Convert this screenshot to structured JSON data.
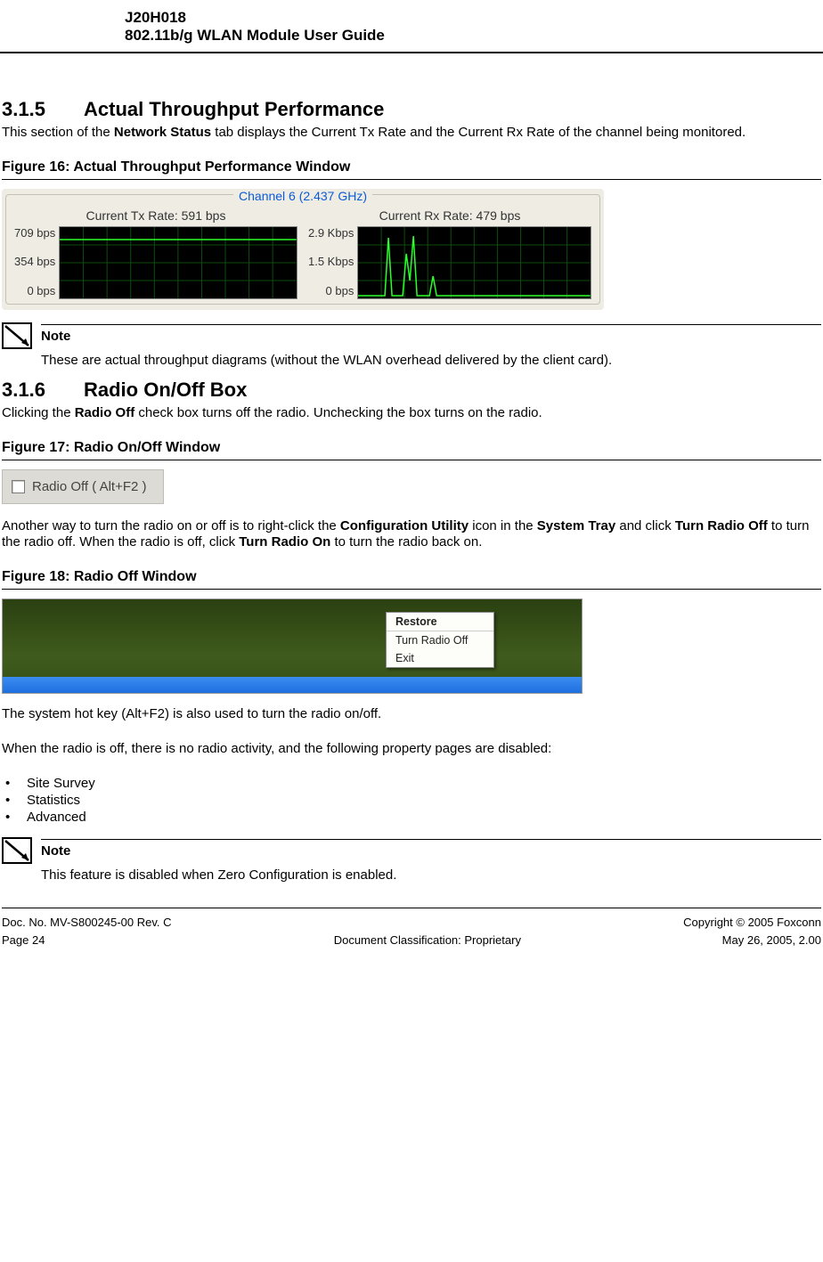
{
  "header": {
    "line1": "J20H018",
    "line2": "802.11b/g WLAN Module User Guide"
  },
  "sec315": {
    "number": "3.1.5",
    "title": "Actual Throughput Performance",
    "para_before": "This section of the ",
    "para_bold1": "Network Status",
    "para_after": " tab displays the Current Tx Rate and the Current Rx Rate of the channel being monitored."
  },
  "fig16": {
    "caption": "Figure 16: Actual Throughput Performance Window",
    "group_title": "Channel 6 (2.437 GHz)",
    "tx_label": "Current Tx Rate: 591 bps",
    "rx_label": "Current Rx Rate: 479 bps",
    "tx_ticks": [
      "709 bps",
      "354 bps",
      "0 bps"
    ],
    "rx_ticks": [
      "2.9 Kbps",
      "1.5 Kbps",
      "0 bps"
    ]
  },
  "note1": {
    "heading": "Note",
    "text": "These are actual throughput diagrams (without the WLAN overhead delivered by the client card)."
  },
  "sec316": {
    "number": "3.1.6",
    "title": "Radio On/Off Box",
    "p1_before": "Clicking the ",
    "p1_bold": "Radio Off",
    "p1_after": " check box turns off the radio. Unchecking the box turns on the radio."
  },
  "fig17": {
    "caption": "Figure 17: Radio On/Off Window",
    "label": "Radio Off  ( Alt+F2 )"
  },
  "p_after_fig17": {
    "s1": "Another way to turn the radio on or off is to right-click the ",
    "b1": "Configuration Utility",
    "s2": " icon in the ",
    "b2": "System Tray",
    "s3": " and click ",
    "b3": "Turn Radio Off",
    "s4": " to turn the radio off. When the radio is off, click ",
    "b4": "Turn Radio On",
    "s5": " to turn the radio back on."
  },
  "fig18": {
    "caption": "Figure 18: Radio Off Window",
    "menu": {
      "restore": "Restore",
      "turn_off": "Turn Radio Off",
      "exit": "Exit"
    }
  },
  "p_after_fig18_1": "The system hot key (Alt+F2) is also used to turn the radio on/off.",
  "p_after_fig18_2": "When the radio is off, there is no radio activity, and the following property pages are disabled:",
  "disabled_list": [
    "Site Survey",
    "Statistics",
    "Advanced"
  ],
  "note2": {
    "heading": "Note",
    "text": "This feature is disabled when Zero Configuration is enabled."
  },
  "footer": {
    "doc_no": "Doc. No. MV-S800245-00 Rev. C",
    "page": "Page 24",
    "classification": "Document Classification: Proprietary",
    "copyright": "Copyright © 2005 Foxconn",
    "date": "May 26, 2005, 2.00"
  },
  "chart_data": [
    {
      "type": "line",
      "title": "Current Tx Rate",
      "ylabel": "bps",
      "ylim": [
        0,
        709
      ],
      "yticks": [
        0,
        354,
        709
      ],
      "series": [
        {
          "name": "Tx",
          "description": "roughly flat line near ~590 bps across the window"
        }
      ]
    },
    {
      "type": "line",
      "title": "Current Rx Rate",
      "ylabel": "Kbps",
      "ylim": [
        0,
        2.9
      ],
      "yticks": [
        0,
        1.5,
        2.9
      ],
      "series": [
        {
          "name": "Rx",
          "description": "mostly ~0.1 Kbps with two narrow spikes up to ~2.5 Kbps near mid-left of window"
        }
      ]
    }
  ]
}
